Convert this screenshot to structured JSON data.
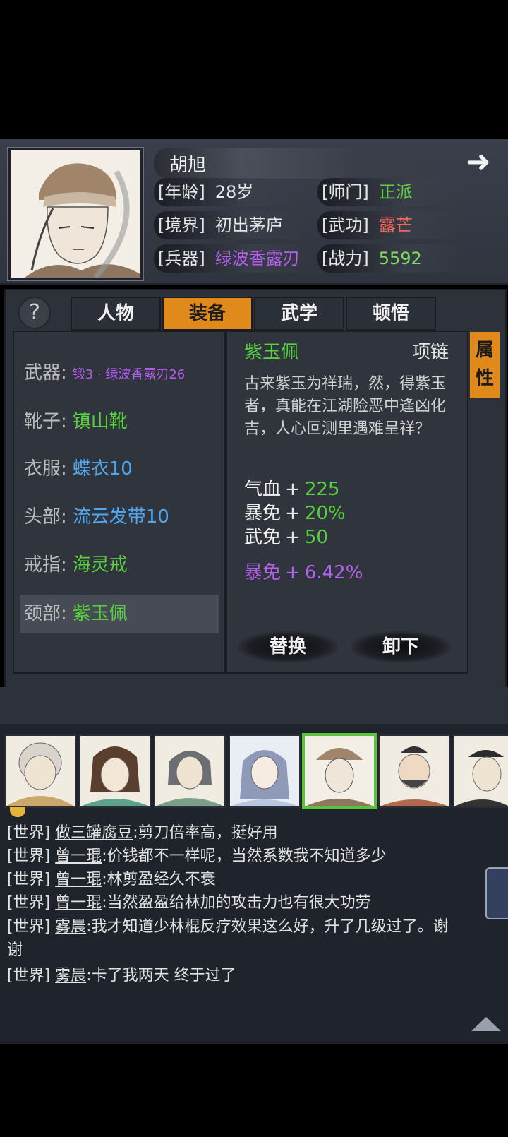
{
  "character": {
    "name": "胡旭",
    "stats": [
      {
        "key": "[年龄]",
        "value": "28岁",
        "color": "white"
      },
      {
        "key": "[师门]",
        "value": "正派",
        "color": "green"
      },
      {
        "key": "[境界]",
        "value": "初出茅庐",
        "color": "white"
      },
      {
        "key": "[武功]",
        "value": "露芒",
        "color": "red"
      },
      {
        "key": "[兵器]",
        "value": "绿波香露刃",
        "color": "purple"
      },
      {
        "key": "[战力]",
        "value": "5592",
        "color": "green"
      }
    ]
  },
  "help_label": "?",
  "tabs": [
    {
      "label": "人物",
      "active": false
    },
    {
      "label": "装备",
      "active": true
    },
    {
      "label": "武学",
      "active": false
    },
    {
      "label": "顿悟",
      "active": false
    }
  ],
  "equipment": [
    {
      "label": "武器:",
      "value": "锻3 · 绿波香露刃26",
      "color": "purple"
    },
    {
      "label": "靴子:",
      "value": "镇山靴",
      "color": "green"
    },
    {
      "label": "衣服:",
      "value": "蝶衣10",
      "color": "blue"
    },
    {
      "label": "头部:",
      "value": "流云发带10",
      "color": "blue"
    },
    {
      "label": "戒指:",
      "value": "海灵戒",
      "color": "green"
    },
    {
      "label": "颈部:",
      "value": "紫玉佩",
      "color": "green",
      "selected": true
    }
  ],
  "detail": {
    "name": "紫玉佩",
    "type": "项链",
    "description": "古来紫玉为祥瑞，然，得紫玉者，真能在江湖险恶中逢凶化吉，人心叵测里遇难呈祥？",
    "attributes": [
      {
        "key": "气血",
        "value": "225"
      },
      {
        "key": "暴免",
        "value": "20%"
      },
      {
        "key": "武免",
        "value": "50"
      }
    ],
    "special": {
      "key": "暴免",
      "value": "6.42%"
    },
    "plus": "+",
    "replace_label": "替换",
    "unequip_label": "卸下",
    "side_tab": [
      "属",
      "性"
    ]
  },
  "chat": [
    {
      "channel": "[世界]",
      "user": "做三罐腐豆",
      "text": ":剪刀倍率高，挺好用"
    },
    {
      "channel": "[世界]",
      "user": "曾一琨",
      "text": ":价钱都不一样呢，当然系数我不知道多少"
    },
    {
      "channel": "[世界]",
      "user": "曾一琨",
      "text": ":林剪盈经久不衰"
    },
    {
      "channel": "[世界]",
      "user": "曾一琨",
      "text": ":当然盈盈给林加的攻击力也有很大功劳"
    },
    {
      "channel": "[世界]",
      "user": "雾晨",
      "text": ":我才知道少林棍反疗效果这么好，升了几级过了。谢"
    },
    {
      "channel": "",
      "user": "",
      "text": "谢"
    },
    {
      "channel": "[世界]",
      "user": "雾晨",
      "text": ":卡了我两天 终于过了"
    }
  ],
  "icons": {
    "arrow": "arrow-right-icon",
    "help": "question-icon",
    "scroll_up": "triangle-up-icon"
  },
  "colors": {
    "accent": "#e08a1c",
    "green": "#59d13e",
    "blue": "#4ea7ee",
    "purple": "#b460ee",
    "red": "#f0685d"
  }
}
